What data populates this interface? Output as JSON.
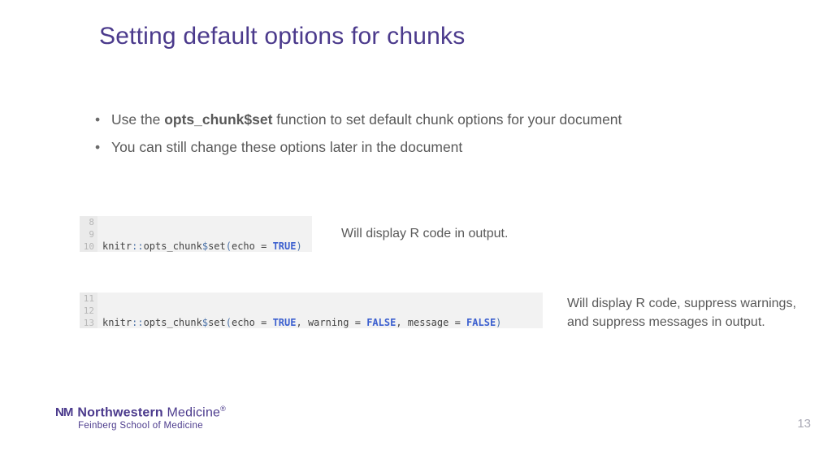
{
  "title": "Setting default options for chunks",
  "bullets": [
    {
      "pre": "Use the ",
      "bold": "opts_chunk$set",
      "post": " function to set default chunk options for your document"
    },
    {
      "pre": "You can still change these options later in the document",
      "bold": "",
      "post": ""
    }
  ],
  "code1": {
    "lines": [
      "8",
      "9",
      "10"
    ],
    "ns": "knitr",
    "dcolon": "::",
    "obj": "opts_chunk",
    "dollar": "$",
    "fn": "set",
    "open": "(",
    "arg1": "echo",
    "eq": " = ",
    "bool1": "TRUE",
    "close": ")"
  },
  "annot1": "Will display R code in output.",
  "code2": {
    "lines": [
      "11",
      "12",
      "13"
    ],
    "ns": "knitr",
    "dcolon": "::",
    "obj": "opts_chunk",
    "dollar": "$",
    "fn": "set",
    "open": "(",
    "arg1": "echo",
    "eq": " = ",
    "bool1": "TRUE",
    "sep1": ", ",
    "arg2": "warning",
    "bool2": "FALSE",
    "sep2": ", ",
    "arg3": "message",
    "bool3": "FALSE",
    "close": ")"
  },
  "annot2": "Will display R code, suppress warnings, and suppress messages in output.",
  "brand": {
    "logo": "NM",
    "main_bold": "Northwestern",
    "main_light": " Medicine",
    "reg": "®",
    "sub": "Feinberg School of Medicine"
  },
  "page": "13"
}
